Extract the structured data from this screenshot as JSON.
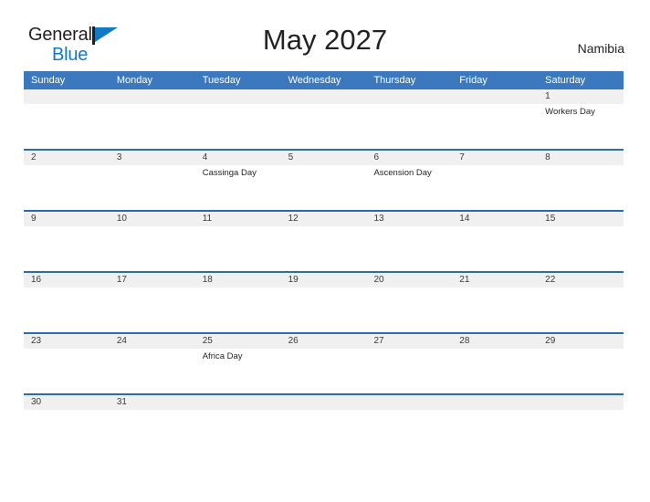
{
  "logo": {
    "text_top": "General",
    "text_bottom": "Blue",
    "icon": "flag-icon",
    "color_dark": "#231f20",
    "color_blue": "#1279c4"
  },
  "header": {
    "title": "May 2027",
    "country": "Namibia"
  },
  "colors": {
    "header_row_bg": "#3b78bd",
    "row_border": "#2b6cb0",
    "date_band_bg": "#f0f0f0",
    "page_bg": "#ffffff"
  },
  "day_headers": [
    "Sunday",
    "Monday",
    "Tuesday",
    "Wednesday",
    "Thursday",
    "Friday",
    "Saturday"
  ],
  "weeks": [
    {
      "short": false,
      "days": [
        {
          "num": "",
          "events": []
        },
        {
          "num": "",
          "events": []
        },
        {
          "num": "",
          "events": []
        },
        {
          "num": "",
          "events": []
        },
        {
          "num": "",
          "events": []
        },
        {
          "num": "",
          "events": []
        },
        {
          "num": "1",
          "events": [
            "Workers Day"
          ]
        }
      ]
    },
    {
      "short": false,
      "days": [
        {
          "num": "2",
          "events": []
        },
        {
          "num": "3",
          "events": []
        },
        {
          "num": "4",
          "events": [
            "Cassinga Day"
          ]
        },
        {
          "num": "5",
          "events": []
        },
        {
          "num": "6",
          "events": [
            "Ascension Day"
          ]
        },
        {
          "num": "7",
          "events": []
        },
        {
          "num": "8",
          "events": []
        }
      ]
    },
    {
      "short": false,
      "days": [
        {
          "num": "9",
          "events": []
        },
        {
          "num": "10",
          "events": []
        },
        {
          "num": "11",
          "events": []
        },
        {
          "num": "12",
          "events": []
        },
        {
          "num": "13",
          "events": []
        },
        {
          "num": "14",
          "events": []
        },
        {
          "num": "15",
          "events": []
        }
      ]
    },
    {
      "short": false,
      "days": [
        {
          "num": "16",
          "events": []
        },
        {
          "num": "17",
          "events": []
        },
        {
          "num": "18",
          "events": []
        },
        {
          "num": "19",
          "events": []
        },
        {
          "num": "20",
          "events": []
        },
        {
          "num": "21",
          "events": []
        },
        {
          "num": "22",
          "events": []
        }
      ]
    },
    {
      "short": false,
      "days": [
        {
          "num": "23",
          "events": []
        },
        {
          "num": "24",
          "events": []
        },
        {
          "num": "25",
          "events": [
            "Africa Day"
          ]
        },
        {
          "num": "26",
          "events": []
        },
        {
          "num": "27",
          "events": []
        },
        {
          "num": "28",
          "events": []
        },
        {
          "num": "29",
          "events": []
        }
      ]
    },
    {
      "short": true,
      "days": [
        {
          "num": "30",
          "events": []
        },
        {
          "num": "31",
          "events": []
        },
        {
          "num": "",
          "events": []
        },
        {
          "num": "",
          "events": []
        },
        {
          "num": "",
          "events": []
        },
        {
          "num": "",
          "events": []
        },
        {
          "num": "",
          "events": []
        }
      ]
    }
  ]
}
